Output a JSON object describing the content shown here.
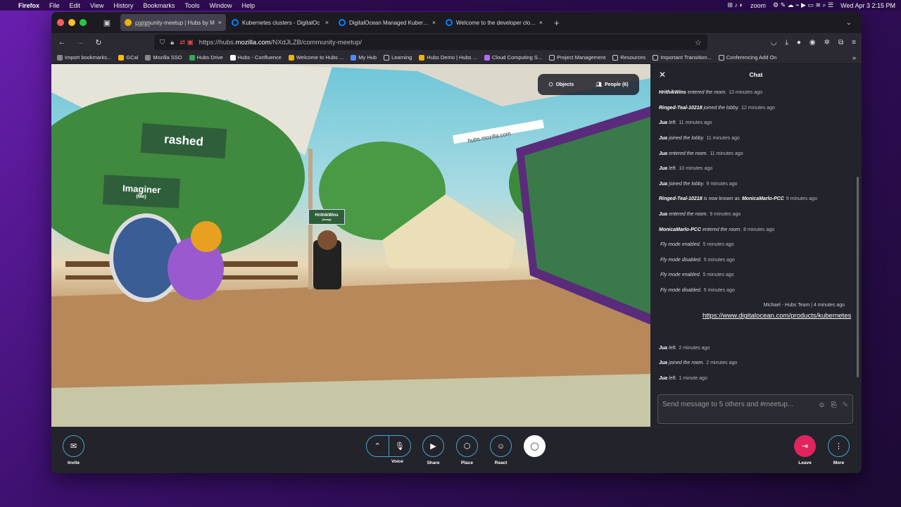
{
  "menubar": {
    "app": "Firefox",
    "items": [
      "File",
      "Edit",
      "View",
      "History",
      "Bookmarks",
      "Tools",
      "Window",
      "Help"
    ],
    "zoom": "zoom",
    "datetime": "Wed Apr 3  2:15 PM"
  },
  "tabs": [
    {
      "title": "community-meetup | Hubs by M",
      "sub": "PLAYING",
      "color": "#f0b400"
    },
    {
      "title": "Kubernetes clusters - DigitalOc",
      "sub": "",
      "color": "#0080ff"
    },
    {
      "title": "DigitalOcean Managed Kuberne",
      "sub": "",
      "color": "#0080ff"
    },
    {
      "title": "Welcome to the developer cloud",
      "sub": "",
      "color": "#0080ff"
    }
  ],
  "url": {
    "prefix": "https://hubs.",
    "host": "mozilla.com",
    "path": "/NXdJLZB/community-meetup/"
  },
  "bookmarks": [
    "Import bookmarks...",
    "GCal",
    "Mozilla SSO",
    "Hubs Drive",
    "Hubs - Confluence",
    "Welcome to Hubs ...",
    "My Hub",
    "Learning",
    "Hubs Demo | Hubs ...",
    "Cloud Computing S...",
    "Project Management",
    "Resources",
    "Important Transition...",
    "Conferencing Add On"
  ],
  "scene": {
    "objects_label": "Objects",
    "people_label": "People (6)",
    "name_rashed": "rashed",
    "name_imaginer": "Imaginer",
    "name_me": "(Me)",
    "name_hrithik": "HrithikWins",
    "name_hrithik_sub": "(Away)"
  },
  "chat": {
    "title": "Chat",
    "messages": [
      {
        "user": "HrithikWins",
        "text": "entered the room.",
        "time": "13 minutes ago"
      },
      {
        "user": "Ringed-Teal-10218",
        "text": "joined the lobby.",
        "time": "12 minutes ago"
      },
      {
        "user": "Jua",
        "text": "left.",
        "time": "11 minutes ago"
      },
      {
        "user": "Jua",
        "text": "joined the lobby.",
        "time": "11 minutes ago"
      },
      {
        "user": "Jua",
        "text": "entered the room.",
        "time": "11 minutes ago"
      },
      {
        "user": "Jua",
        "text": "left.",
        "time": "10 minutes ago"
      },
      {
        "user": "Jua",
        "text": "joined the lobby.",
        "time": "9 minutes ago"
      },
      {
        "user": "Ringed-Teal-10218",
        "text": "is now known as",
        "user2": "MonicaMarlo-PCC",
        "time": "9 minutes ago"
      },
      {
        "user": "Jua",
        "text": "entered the room.",
        "time": "9 minutes ago"
      },
      {
        "user": "MonicaMarlo-PCC",
        "text": "entered the room.",
        "time": "8 minutes ago"
      },
      {
        "user": "",
        "text": "Fly mode enabled.",
        "time": "5 minutes ago"
      },
      {
        "user": "",
        "text": "Fly mode disabled.",
        "time": "5 minutes ago"
      },
      {
        "user": "",
        "text": "Fly mode enabled.",
        "time": "5 minutes ago"
      },
      {
        "user": "",
        "text": "Fly mode disabled.",
        "time": "5 minutes ago"
      }
    ],
    "post_header": "Michael - Hubs Team | 4 minutes ago",
    "post_link": "https://www.digitalocean.com/products/kubernetes",
    "messages_after": [
      {
        "user": "Jua",
        "text": "left.",
        "time": "2 minutes ago"
      },
      {
        "user": "Jua",
        "text": "joined the room.",
        "time": "2 minutes ago"
      },
      {
        "user": "Jua",
        "text": "left.",
        "time": "1 minute ago"
      }
    ],
    "input_placeholder": "Send message to 5 others and #meetup..."
  },
  "toolbar": {
    "invite": "Invite",
    "voice": "Voice",
    "share": "Share",
    "place": "Place",
    "react": "React",
    "leave": "Leave",
    "more": "More"
  },
  "colors": {
    "leave": "#e0245e",
    "accent": "#4aa3c8"
  }
}
